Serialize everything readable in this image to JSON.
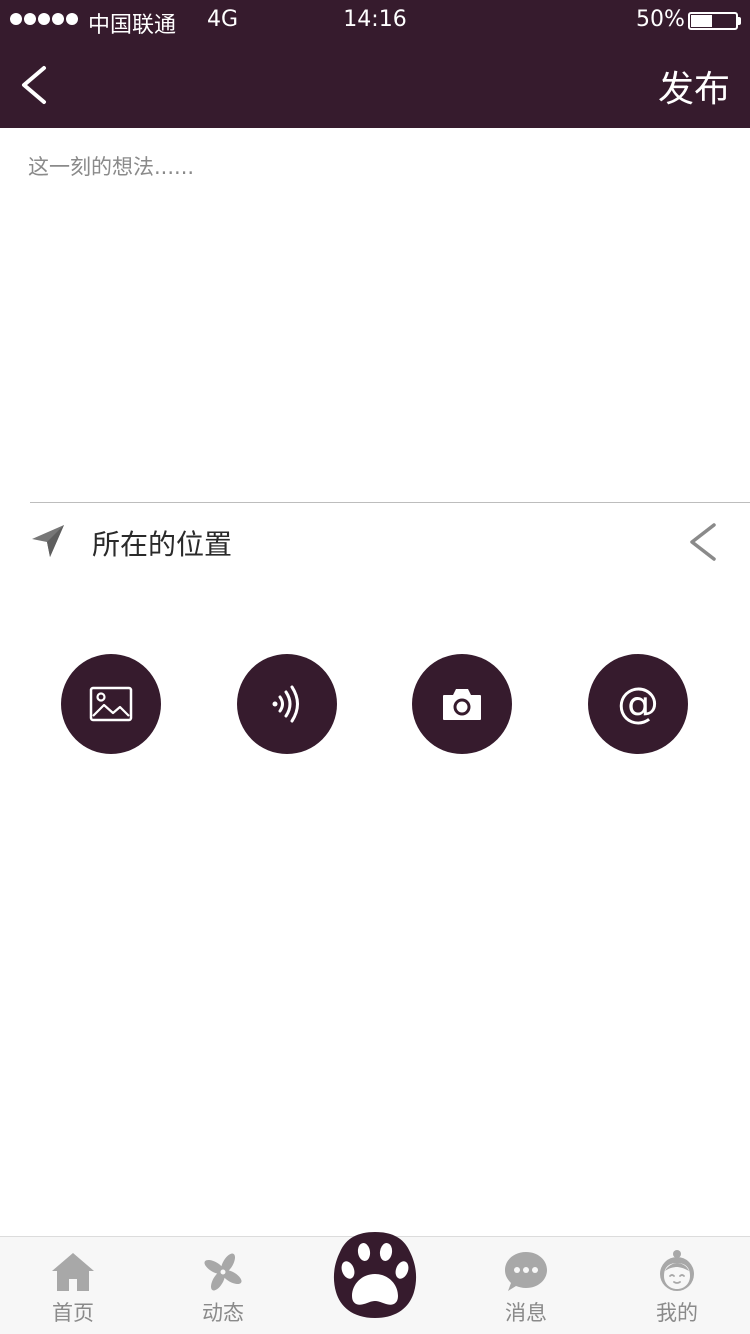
{
  "status_bar": {
    "carrier": "中国联通",
    "network": "4G",
    "time": "14:16",
    "battery_percent": "50%",
    "battery_level": 0.5
  },
  "header": {
    "back_icon": "chevron-left-icon",
    "publish_label": "发布"
  },
  "editor": {
    "placeholder": "这一刻的想法......",
    "value": ""
  },
  "location": {
    "icon": "location-arrow-icon",
    "label": "所在的位置",
    "arrow_icon": "chevron-left-icon"
  },
  "actions": [
    {
      "id": "image",
      "icon": "image-icon"
    },
    {
      "id": "voice",
      "icon": "sound-wave-icon"
    },
    {
      "id": "camera",
      "icon": "camera-icon"
    },
    {
      "id": "mention",
      "icon": "at-icon",
      "glyph": "@"
    }
  ],
  "tabbar": {
    "items": [
      {
        "label": "首页",
        "icon": "home-icon"
      },
      {
        "label": "动态",
        "icon": "pinwheel-icon"
      },
      {
        "label": "",
        "icon": "paw-icon"
      },
      {
        "label": "消息",
        "icon": "chat-bubble-icon"
      },
      {
        "label": "我的",
        "icon": "person-icon"
      }
    ]
  },
  "colors": {
    "primary": "#361b2d",
    "tab_inactive": "#8a8a8a",
    "tab_icon": "#a8a8a8",
    "background": "#ffffff"
  }
}
